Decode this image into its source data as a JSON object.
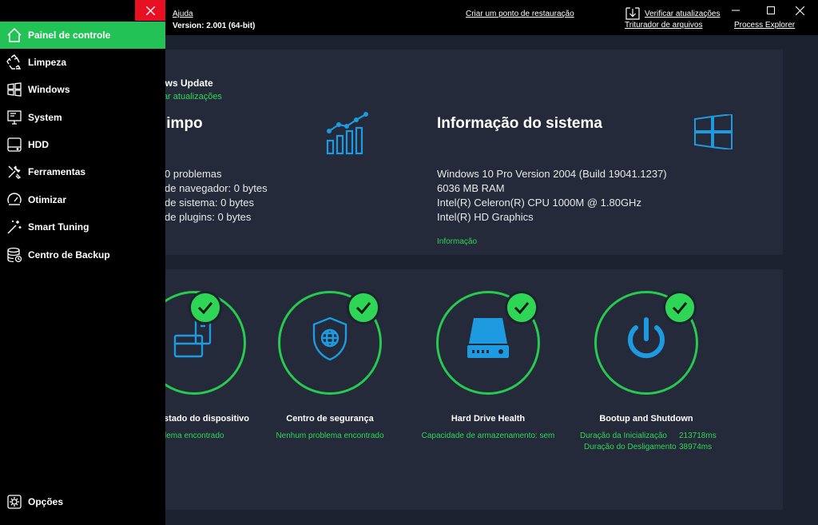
{
  "topbar": {
    "help": "Ajuda",
    "version": "Version: 2.001 (64-bit)",
    "restore_point": "Criar um ponto de restauração",
    "check_updates": "Verificar atualizações",
    "file_shredder": "Triturador de arquivos",
    "process_explorer": "Process Explorer"
  },
  "sidebar": {
    "items": [
      {
        "label": "Painel de controle",
        "icon": "home-icon",
        "active": true
      },
      {
        "label": "Limpeza",
        "icon": "recycle-icon"
      },
      {
        "label": "Windows",
        "icon": "windows-icon"
      },
      {
        "label": "System",
        "icon": "monitor-icon"
      },
      {
        "label": "HDD",
        "icon": "hdd-icon"
      },
      {
        "label": "Ferramentas",
        "icon": "tools-icon"
      },
      {
        "label": "Otimizar",
        "icon": "gauge-icon"
      },
      {
        "label": "Smart Tuning",
        "icon": "magic-wand-icon"
      },
      {
        "label": "Centro de Backup",
        "icon": "database-icon"
      }
    ],
    "options": "Opções"
  },
  "windows_update": {
    "title": "lows Update",
    "link": "isar atualizações"
  },
  "clean": {
    "title": "limpo",
    "problems": "0 problemas",
    "browser": "de navegador: 0 bytes",
    "system": "de sistema: 0 bytes",
    "plugins": "de plugins: 0 bytes"
  },
  "sysinfo": {
    "title": "Informação do sistema",
    "os": "Windows 10 Pro Version 2004 (Build 19041.1237)",
    "ram": "6036 MB RAM",
    "cpu": "Intel(R) Celeron(R) CPU 1000M @ 1.80GHz",
    "gpu": "Intel(R) HD Graphics",
    "link": "Informação"
  },
  "cards": [
    {
      "title": "stado do dispositivo",
      "status": "lema encontrado",
      "icon": "device-icon"
    },
    {
      "title": "Centro de segurança",
      "status": "Nenhum problema encontrado",
      "icon": "shield-globe-icon"
    },
    {
      "title": "Hard Drive Health",
      "status": "Capacidade de armazenamento: sem",
      "icon": "hard-drive-icon"
    },
    {
      "title": "Bootup and Shutdown",
      "status_boot_label": "Duração da Inicialização",
      "status_boot_value": "213718ms",
      "status_shutdown_label": "Duração do Desligamento",
      "status_shutdown_value": "38974ms",
      "icon": "power-icon"
    }
  ],
  "colors": {
    "accent_green": "#2fd655",
    "active_nav": "#23c256",
    "icon_blue": "#1e9be0",
    "close_red": "#e81123",
    "panel": "#242a3a",
    "background": "#1d2230"
  }
}
